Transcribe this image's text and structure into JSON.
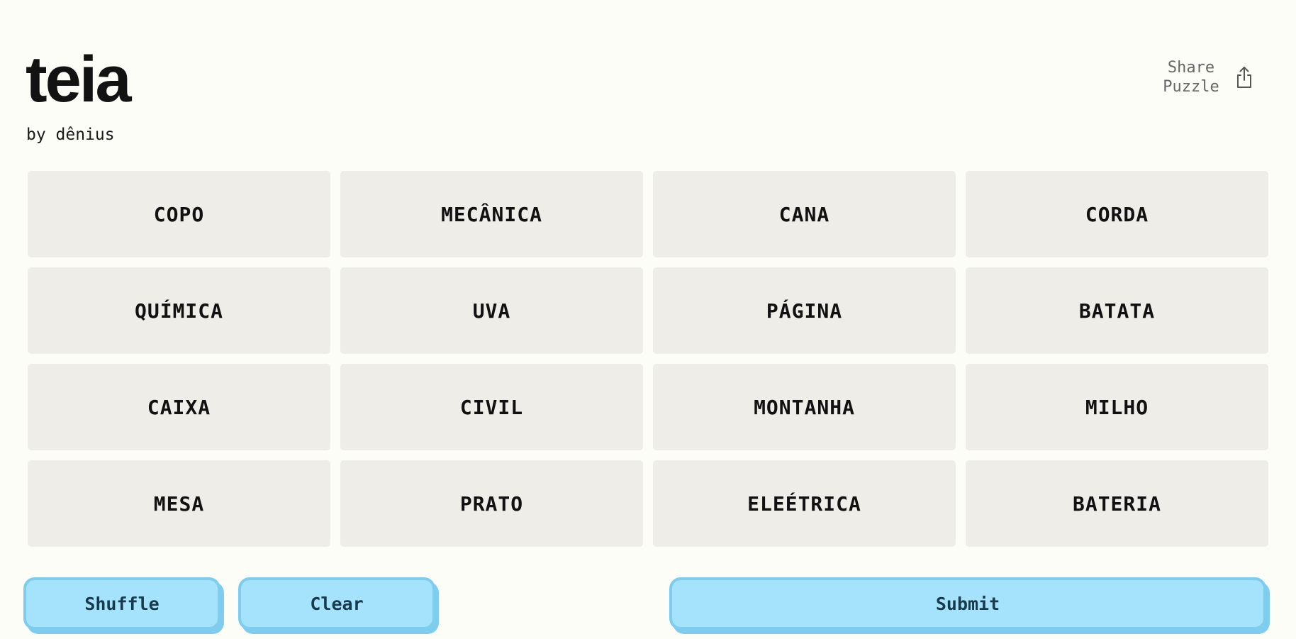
{
  "header": {
    "title": "teia",
    "author": "by dênius",
    "share_label": "Share Puzzle",
    "share_icon": "share-icon"
  },
  "board": {
    "tiles": [
      "COPO",
      "MECÂNICA",
      "CANA",
      "CORDA",
      "QUÍMICA",
      "UVA",
      "PÁGINA",
      "BATATA",
      "CAIXA",
      "CIVIL",
      "MONTANHA",
      "MILHO",
      "MESA",
      "PRATO",
      "ELEÉTRICA",
      "BATERIA"
    ]
  },
  "controls": {
    "shuffle_label": "Shuffle",
    "clear_label": "Clear",
    "submit_label": "Submit"
  },
  "colors": {
    "background": "#fdfdf7",
    "tile": "#eeede7",
    "button": "#a4e3fb",
    "button_border": "#7fcdee",
    "button_text": "#183a4c"
  }
}
